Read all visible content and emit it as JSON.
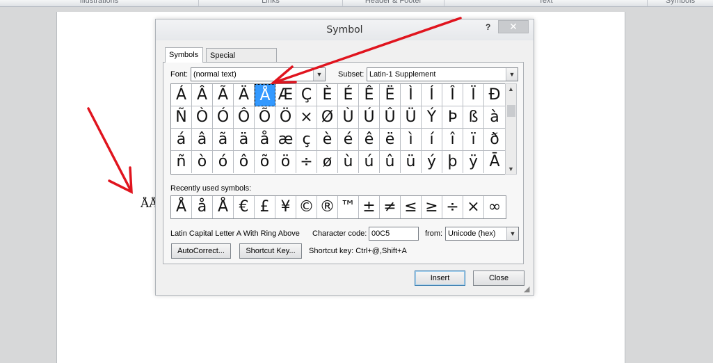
{
  "ribbon": {
    "groups": [
      "Illustrations",
      "Links",
      "Header & Footer",
      "Text",
      "Symbols"
    ]
  },
  "document": {
    "text": "ÅÅ"
  },
  "dialog": {
    "title": "Symbol",
    "help_label": "?",
    "close_label": "✕",
    "tabs": [
      {
        "label": "Symbols",
        "active": true
      },
      {
        "label": "Special Characters",
        "active": false
      }
    ],
    "font": {
      "label": "Font:",
      "value": "(normal text)"
    },
    "subset": {
      "label": "Subset:",
      "value": "Latin-1 Supplement"
    },
    "symbols_grid": [
      [
        "Á",
        "Â",
        "Ã",
        "Ä",
        "Å",
        "Æ",
        "Ç",
        "È",
        "É",
        "Ê",
        "Ë",
        "Ì",
        "Í",
        "Î",
        "Ï",
        "Ð"
      ],
      [
        "Ñ",
        "Ò",
        "Ó",
        "Ô",
        "Õ",
        "Ö",
        "×",
        "Ø",
        "Ù",
        "Ú",
        "Û",
        "Ü",
        "Ý",
        "Þ",
        "ß",
        "à"
      ],
      [
        "á",
        "â",
        "ã",
        "ä",
        "å",
        "æ",
        "ç",
        "è",
        "é",
        "ê",
        "ë",
        "ì",
        "í",
        "î",
        "ï",
        "ð"
      ],
      [
        "ñ",
        "ò",
        "ó",
        "ô",
        "õ",
        "ö",
        "÷",
        "ø",
        "ù",
        "ú",
        "û",
        "ü",
        "ý",
        "þ",
        "ÿ",
        "Ā"
      ]
    ],
    "selected_symbol": "Å",
    "recently_used_label": "Recently used symbols:",
    "recently_used": [
      "Å",
      "å",
      "Å",
      "€",
      "£",
      "¥",
      "©",
      "®",
      "™",
      "±",
      "≠",
      "≤",
      "≥",
      "÷",
      "×",
      "∞"
    ],
    "character_name": "Latin Capital Letter A With Ring Above",
    "character_code": {
      "label": "Character code:",
      "value": "00C5"
    },
    "from": {
      "label": "from:",
      "value": "Unicode (hex)"
    },
    "autocorrect_label": "AutoCorrect...",
    "shortcut_key_button_label": "Shortcut Key...",
    "shortcut_key_text": "Shortcut key: Ctrl+@,Shift+A",
    "insert_label": "Insert",
    "close_button_label": "Close"
  },
  "colors": {
    "selection": "#3399ff",
    "annotation": "#e0141e"
  }
}
